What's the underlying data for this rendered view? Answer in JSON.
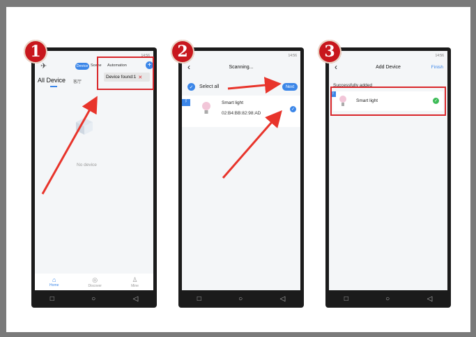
{
  "badges": [
    "1",
    "2",
    "3"
  ],
  "screen1": {
    "status_time": "14:56",
    "tabs": {
      "device": "Device",
      "scene": "Scene",
      "automation": "Automation"
    },
    "all_device": "All Device",
    "room_tab": "客厅",
    "popup": "Device found:1",
    "empty": "No device",
    "bottom_nav": [
      "Home",
      "Discover",
      "Mine"
    ]
  },
  "screen2": {
    "status_time": "14:56",
    "title": "Scanning...",
    "select_all": "Select all",
    "next": "Next",
    "device_name": "Smart light",
    "device_mac": "02:B4:BB:82:98:AD"
  },
  "screen3": {
    "status_time": "14:56",
    "title": "Add Device",
    "finish": "Finish",
    "section": "Successfully added",
    "device_name": "Smart light"
  },
  "colors": {
    "accent": "#3b86e8",
    "highlight": "#d9262a",
    "badge": "#c8171d",
    "success": "#3dbb57"
  }
}
